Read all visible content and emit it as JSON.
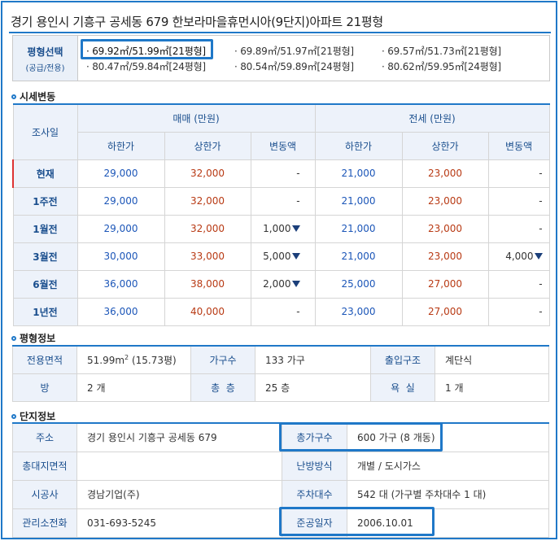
{
  "title": "경기 용인시 기흥구 공세동 679 한보라마을휴먼시아(9단지)아파트 21평형",
  "size_select": {
    "label": "평형선택",
    "sublabel": "(공급/전용)",
    "options": [
      "· 69.92㎡/51.99㎡[21평형]",
      "· 69.89㎡/51.97㎡[21평형]",
      "· 69.57㎡/51.73㎡[21평형]",
      "· 80.47㎡/59.84㎡[24평형]",
      "· 80.54㎡/59.89㎡[24평형]",
      "· 80.62㎡/59.95㎡[24평형]"
    ],
    "selected_index": 0,
    "highlight_color": "#1f78c8"
  },
  "price_section": {
    "heading": "시세변동",
    "col_date": "조사일",
    "group_sale": "매매 (만원)",
    "group_jeonse": "전세 (만원)",
    "sub_low": "하한가",
    "sub_high": "상한가",
    "sub_change": "변동액",
    "rows": [
      {
        "date": "현재",
        "s_low": "29,000",
        "s_high": "32,000",
        "s_chg": "-",
        "s_down": false,
        "j_low": "21,000",
        "j_high": "23,000",
        "j_chg": "-",
        "j_down": false
      },
      {
        "date": "1주전",
        "s_low": "29,000",
        "s_high": "32,000",
        "s_chg": "-",
        "s_down": false,
        "j_low": "21,000",
        "j_high": "23,000",
        "j_chg": "-",
        "j_down": false
      },
      {
        "date": "1월전",
        "s_low": "29,000",
        "s_high": "32,000",
        "s_chg": "1,000",
        "s_down": true,
        "j_low": "21,000",
        "j_high": "23,000",
        "j_chg": "-",
        "j_down": false
      },
      {
        "date": "3월전",
        "s_low": "30,000",
        "s_high": "33,000",
        "s_chg": "5,000",
        "s_down": true,
        "j_low": "21,000",
        "j_high": "23,000",
        "j_chg": "4,000",
        "j_down": true
      },
      {
        "date": "6월전",
        "s_low": "36,000",
        "s_high": "38,000",
        "s_chg": "2,000",
        "s_down": true,
        "j_low": "25,000",
        "j_high": "27,000",
        "j_chg": "-",
        "j_down": false
      },
      {
        "date": "1년전",
        "s_low": "36,000",
        "s_high": "40,000",
        "s_chg": "-",
        "s_down": false,
        "j_low": "23,000",
        "j_high": "27,000",
        "j_chg": "-",
        "j_down": false
      }
    ]
  },
  "size_info": {
    "heading": "평형정보",
    "area_label": "전용면적",
    "area_value": "51.99m",
    "area_sup": "2",
    "area_pyeong": " (15.73평)",
    "households_label": "가구수",
    "households_value": "133 가구",
    "entrance_label": "출입구조",
    "entrance_value": "계단식",
    "rooms_label": "방",
    "rooms_value": "2 개",
    "floors_label": "총  층",
    "floors_value": "25 층",
    "bath_label": "욕  실",
    "bath_value": "1 개"
  },
  "complex_info": {
    "heading": "단지정보",
    "address_label": "주소",
    "address_value": "경기 용인시 기흥구 공세동 679",
    "total_households_label": "총가구수",
    "total_households_value": "600 가구 (8 개동)",
    "land_area_label": "총대지면적",
    "land_area_value": "",
    "heating_label": "난방방식",
    "heating_value": "개별 / 도시가스",
    "builder_label": "시공사",
    "builder_value": "경남기업(주)",
    "parking_label": "주차대수",
    "parking_value": "542 대 (가구별 주차대수 1 대)",
    "office_phone_label": "관리소전화",
    "office_phone_value": "031-693-5245",
    "completion_label": "준공일자",
    "completion_value": "2006.10.01"
  }
}
